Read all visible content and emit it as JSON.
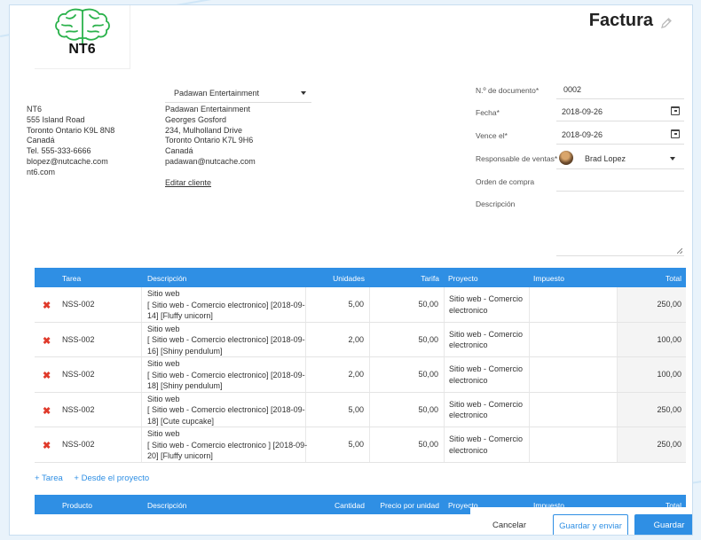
{
  "header": {
    "title": "Factura",
    "logo_text": "NT6"
  },
  "company": {
    "lines": [
      "NT6",
      "555 Island Road",
      "Toronto Ontario K9L 8N8",
      "Canadá",
      "Tel. 555-333-6666",
      "blopez@nutcache.com",
      "nt6.com"
    ]
  },
  "client": {
    "selected": "Padawan Entertainment",
    "lines": [
      "Padawan Entertainment",
      "Georges Gosford",
      "234, Mulholland Drive",
      "Toronto Ontario K7L 9H6",
      "Canadá",
      "padawan@nutcache.com"
    ],
    "edit_link": "Editar cliente"
  },
  "form": {
    "doc_number_label": "N.º de documento*",
    "doc_number_value": "0002",
    "date_label": "Fecha*",
    "date_value": "2018-09-26",
    "due_label": "Vence el*",
    "due_value": "2018-09-26",
    "sales_label": "Responsable de ventas*",
    "sales_value": "Brad Lopez",
    "po_label": "Orden de compra",
    "po_value": "",
    "desc_label": "Descripción",
    "desc_value": ""
  },
  "tasks_table": {
    "headers": [
      "Tarea",
      "Descripción",
      "Unidades",
      "Tarifa",
      "Proyecto",
      "Impuesto",
      "Total"
    ],
    "rows": [
      {
        "task": "NSS-002",
        "desc": [
          "Sitio web",
          "[ Sitio web - Comercio electronico] [2018-09-",
          "14] [Fluffy unicorn]"
        ],
        "units": "5,00",
        "rate": "50,00",
        "project": [
          "Sitio web - Comercio",
          "electronico"
        ],
        "tax": "",
        "total": "250,00"
      },
      {
        "task": "NSS-002",
        "desc": [
          "Sitio web",
          "[ Sitio web - Comercio electronico] [2018-09-",
          "16] [Shiny pendulum]"
        ],
        "units": "2,00",
        "rate": "50,00",
        "project": [
          "Sitio web - Comercio",
          "electronico"
        ],
        "tax": "",
        "total": "100,00"
      },
      {
        "task": "NSS-002",
        "desc": [
          "Sitio web",
          "[ Sitio web - Comercio electronico] [2018-09-",
          "18] [Shiny pendulum]"
        ],
        "units": "2,00",
        "rate": "50,00",
        "project": [
          "Sitio web - Comercio",
          "electronico"
        ],
        "tax": "",
        "total": "100,00"
      },
      {
        "task": "NSS-002",
        "desc": [
          "Sitio web",
          "[ Sitio web - Comercio electronico] [2018-09-",
          "18] [Cute cupcake]"
        ],
        "units": "5,00",
        "rate": "50,00",
        "project": [
          "Sitio web - Comercio",
          "electronico"
        ],
        "tax": "",
        "total": "250,00"
      },
      {
        "task": "NSS-002",
        "desc": [
          "Sitio web",
          "[ Sitio web - Comercio electronico ] [2018-09-",
          "20] [Fluffy unicorn]"
        ],
        "units": "5,00",
        "rate": "50,00",
        "project": [
          "Sitio web - Comercio",
          "electronico"
        ],
        "tax": "",
        "total": "250,00"
      }
    ]
  },
  "add_links": {
    "task": "+ Tarea",
    "from_project": "+ Desde el proyecto"
  },
  "products_table": {
    "headers": [
      "Producto",
      "Descripción",
      "Cantidad",
      "Precio por unidad",
      "Proyecto",
      "Impuesto",
      "Total"
    ]
  },
  "footer": {
    "cancel": "Cancelar",
    "save_send": "Guardar y enviar",
    "save": "Guardar"
  },
  "colors": {
    "accent": "#2f8fe4",
    "delete": "#e03a2b",
    "logo_green": "#2bb24c"
  }
}
